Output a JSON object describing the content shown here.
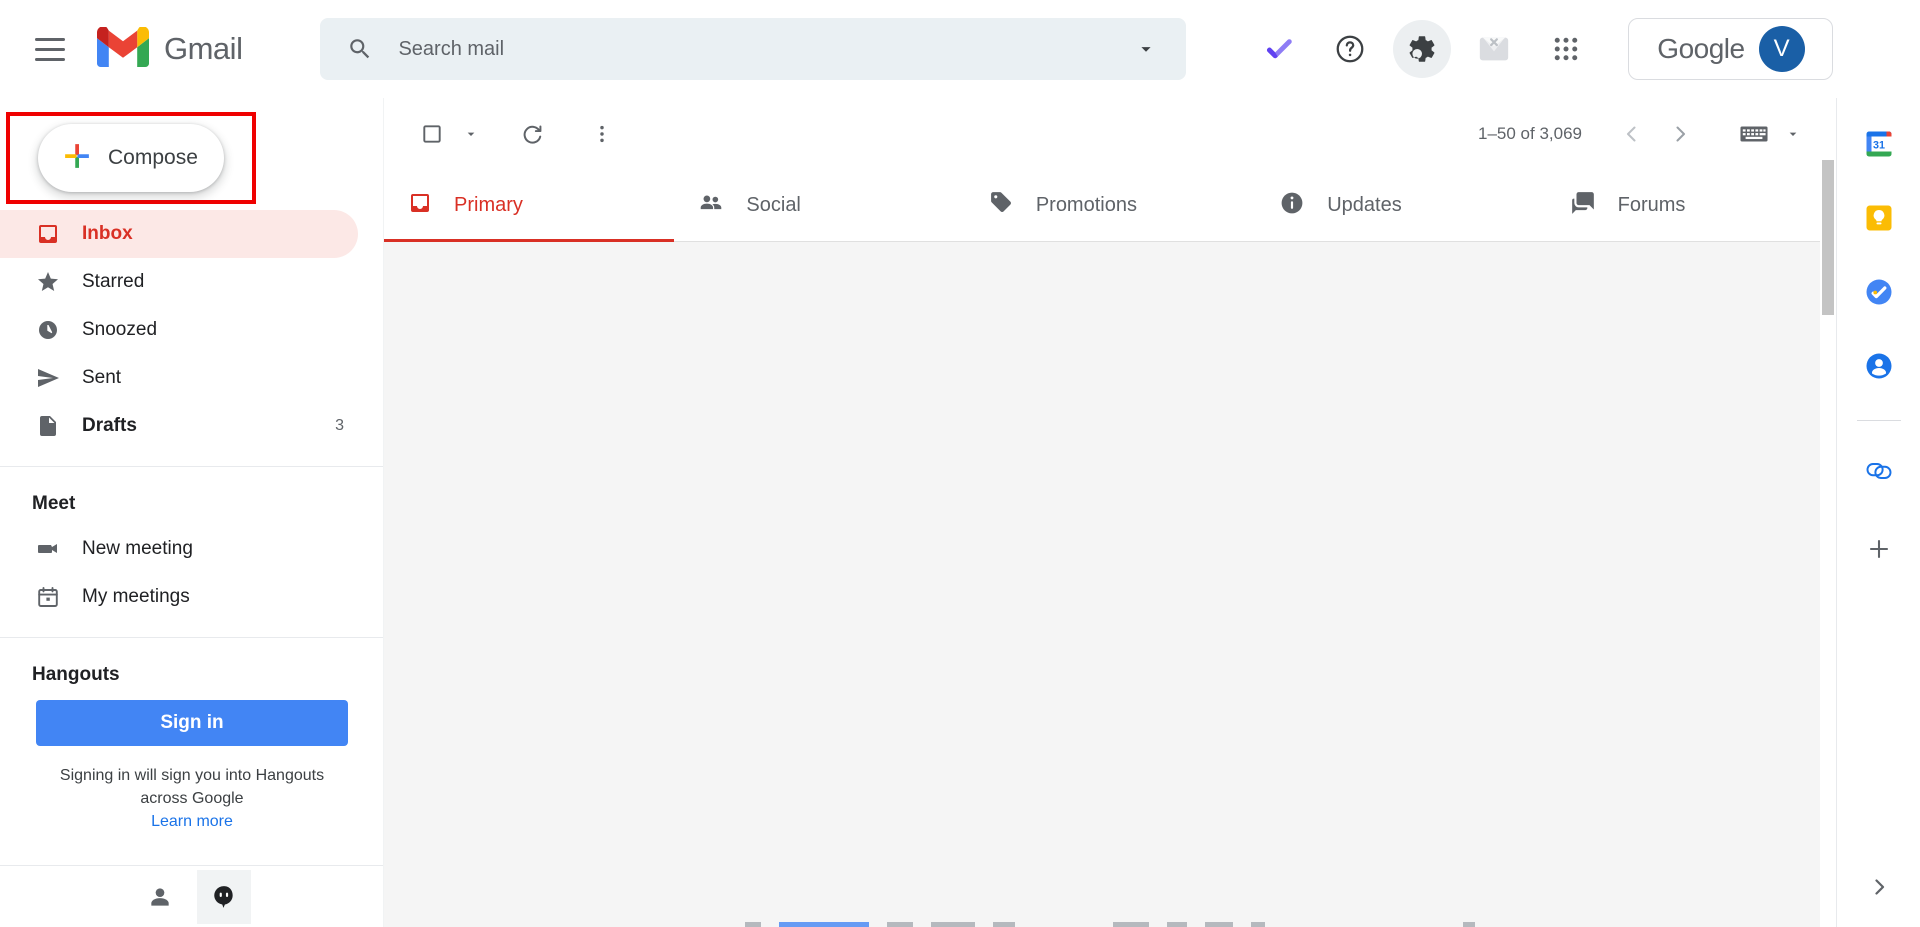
{
  "header": {
    "menu_icon": "hamburger-menu-icon",
    "brand": "Gmail",
    "brand_logo_icon": "gmail-m-logo-icon",
    "search": {
      "placeholder": "Search mail",
      "value": "",
      "icon": "search-icon",
      "options_icon": "search-options-chevron-down-icon"
    },
    "actions": [
      {
        "name": "tasks-check-icon",
        "label": "Tasks"
      },
      {
        "name": "help-question-icon",
        "label": "Support"
      },
      {
        "name": "settings-gear-icon",
        "label": "Settings"
      },
      {
        "name": "mail-disabled-icon",
        "label": "Mail unavailable"
      },
      {
        "name": "apps-grid-icon",
        "label": "Google apps"
      }
    ],
    "account": {
      "word": "Google",
      "avatar_initial": "V"
    }
  },
  "sidebar": {
    "compose": {
      "label": "Compose",
      "icon": "multicolor-plus-icon",
      "highlighted": true,
      "highlight_color": "#ef0000"
    },
    "nav_items": [
      {
        "label": "Inbox",
        "icon": "inbox-icon",
        "count": "",
        "selected": true
      },
      {
        "label": "Starred",
        "icon": "star-icon",
        "count": "",
        "selected": false
      },
      {
        "label": "Snoozed",
        "icon": "clock-icon",
        "count": "",
        "selected": false
      },
      {
        "label": "Sent",
        "icon": "send-icon",
        "count": "",
        "selected": false
      },
      {
        "label": "Drafts",
        "icon": "drafts-icon",
        "count": "3",
        "selected": false,
        "bold": true
      }
    ],
    "meet": {
      "title": "Meet",
      "items": [
        {
          "label": "New meeting",
          "icon": "video-camera-icon"
        },
        {
          "label": "My meetings",
          "icon": "calendar-icon"
        }
      ]
    },
    "hangouts": {
      "title": "Hangouts",
      "signin_label": "Sign in",
      "note_line1": "Signing in will sign you into Hangouts",
      "note_line2": "across Google",
      "learn_more": "Learn more",
      "footer_icons": [
        {
          "name": "person-icon",
          "selected": false
        },
        {
          "name": "hangouts-quote-icon",
          "selected": true
        }
      ]
    }
  },
  "toolbar": {
    "select_all_checkbox_icon": "checkbox-unchecked-icon",
    "select_dropdown_icon": "chevron-down-icon",
    "refresh_icon": "refresh-icon",
    "more_icon": "more-vertical-icon",
    "page_range": "1–50 of 3,069",
    "prev_icon": "chevron-left-icon",
    "next_icon": "chevron-right-icon",
    "keyboard_icon": "keyboard-icon",
    "keyboard_dropdown_icon": "chevron-down-icon"
  },
  "tabs": [
    {
      "label": "Primary",
      "icon": "inbox-tab-icon",
      "active": true
    },
    {
      "label": "Social",
      "icon": "people-icon",
      "active": false
    },
    {
      "label": "Promotions",
      "icon": "tag-icon",
      "active": false
    },
    {
      "label": "Updates",
      "icon": "info-circle-icon",
      "active": false
    },
    {
      "label": "Forums",
      "icon": "forums-chat-icon",
      "active": false
    }
  ],
  "right_rail": {
    "icons": [
      {
        "name": "google-calendar-icon",
        "label": "Calendar",
        "badge": "31"
      },
      {
        "name": "google-keep-icon",
        "label": "Keep",
        "badge": ""
      },
      {
        "name": "google-tasks-icon",
        "label": "Tasks",
        "badge": ""
      },
      {
        "name": "google-contacts-icon",
        "label": "Contacts",
        "badge": ""
      },
      {
        "name": "add-onlink-icon",
        "label": "Add-ons",
        "badge": ""
      },
      {
        "name": "plus-icon",
        "label": "Get add-ons",
        "badge": ""
      }
    ],
    "expand_icon": "chevron-right-icon"
  },
  "colors": {
    "gmail_red": "#d93025",
    "inbox_highlight_bg": "#fce8e6",
    "highlight_box": "#ef0000",
    "blue_accent": "#4285f4",
    "avatar_blue": "#1a5fa6",
    "list_bg": "#f5f5f5"
  }
}
